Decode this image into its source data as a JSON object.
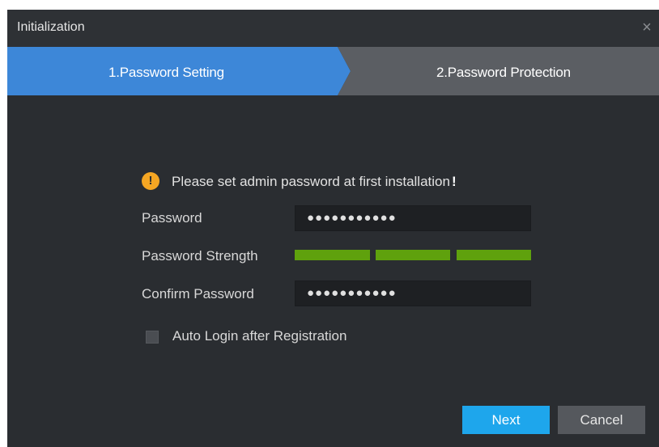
{
  "window": {
    "title": "Initialization",
    "close_glyph": "×"
  },
  "steps": [
    {
      "label": "1.Password Setting",
      "active": true,
      "color": "#3d87d8"
    },
    {
      "label": "2.Password Protection",
      "active": false,
      "color": "#5b5e63"
    }
  ],
  "form": {
    "warning_text": "Please set admin password at first installation",
    "warning_bang": "!",
    "warning_icon": "warning-circle-icon",
    "password_label": "Password",
    "password_value": "●●●●●●●●●●●",
    "strength_label": "Password Strength",
    "strength_segments_filled": 3,
    "strength_segments_total": 3,
    "strength_color": "#5fa10d",
    "confirm_label": "Confirm Password",
    "confirm_value": "●●●●●●●●●●●",
    "auto_login_label": "Auto Login after Registration",
    "auto_login_checked": false
  },
  "buttons": {
    "next": "Next",
    "cancel": "Cancel"
  }
}
